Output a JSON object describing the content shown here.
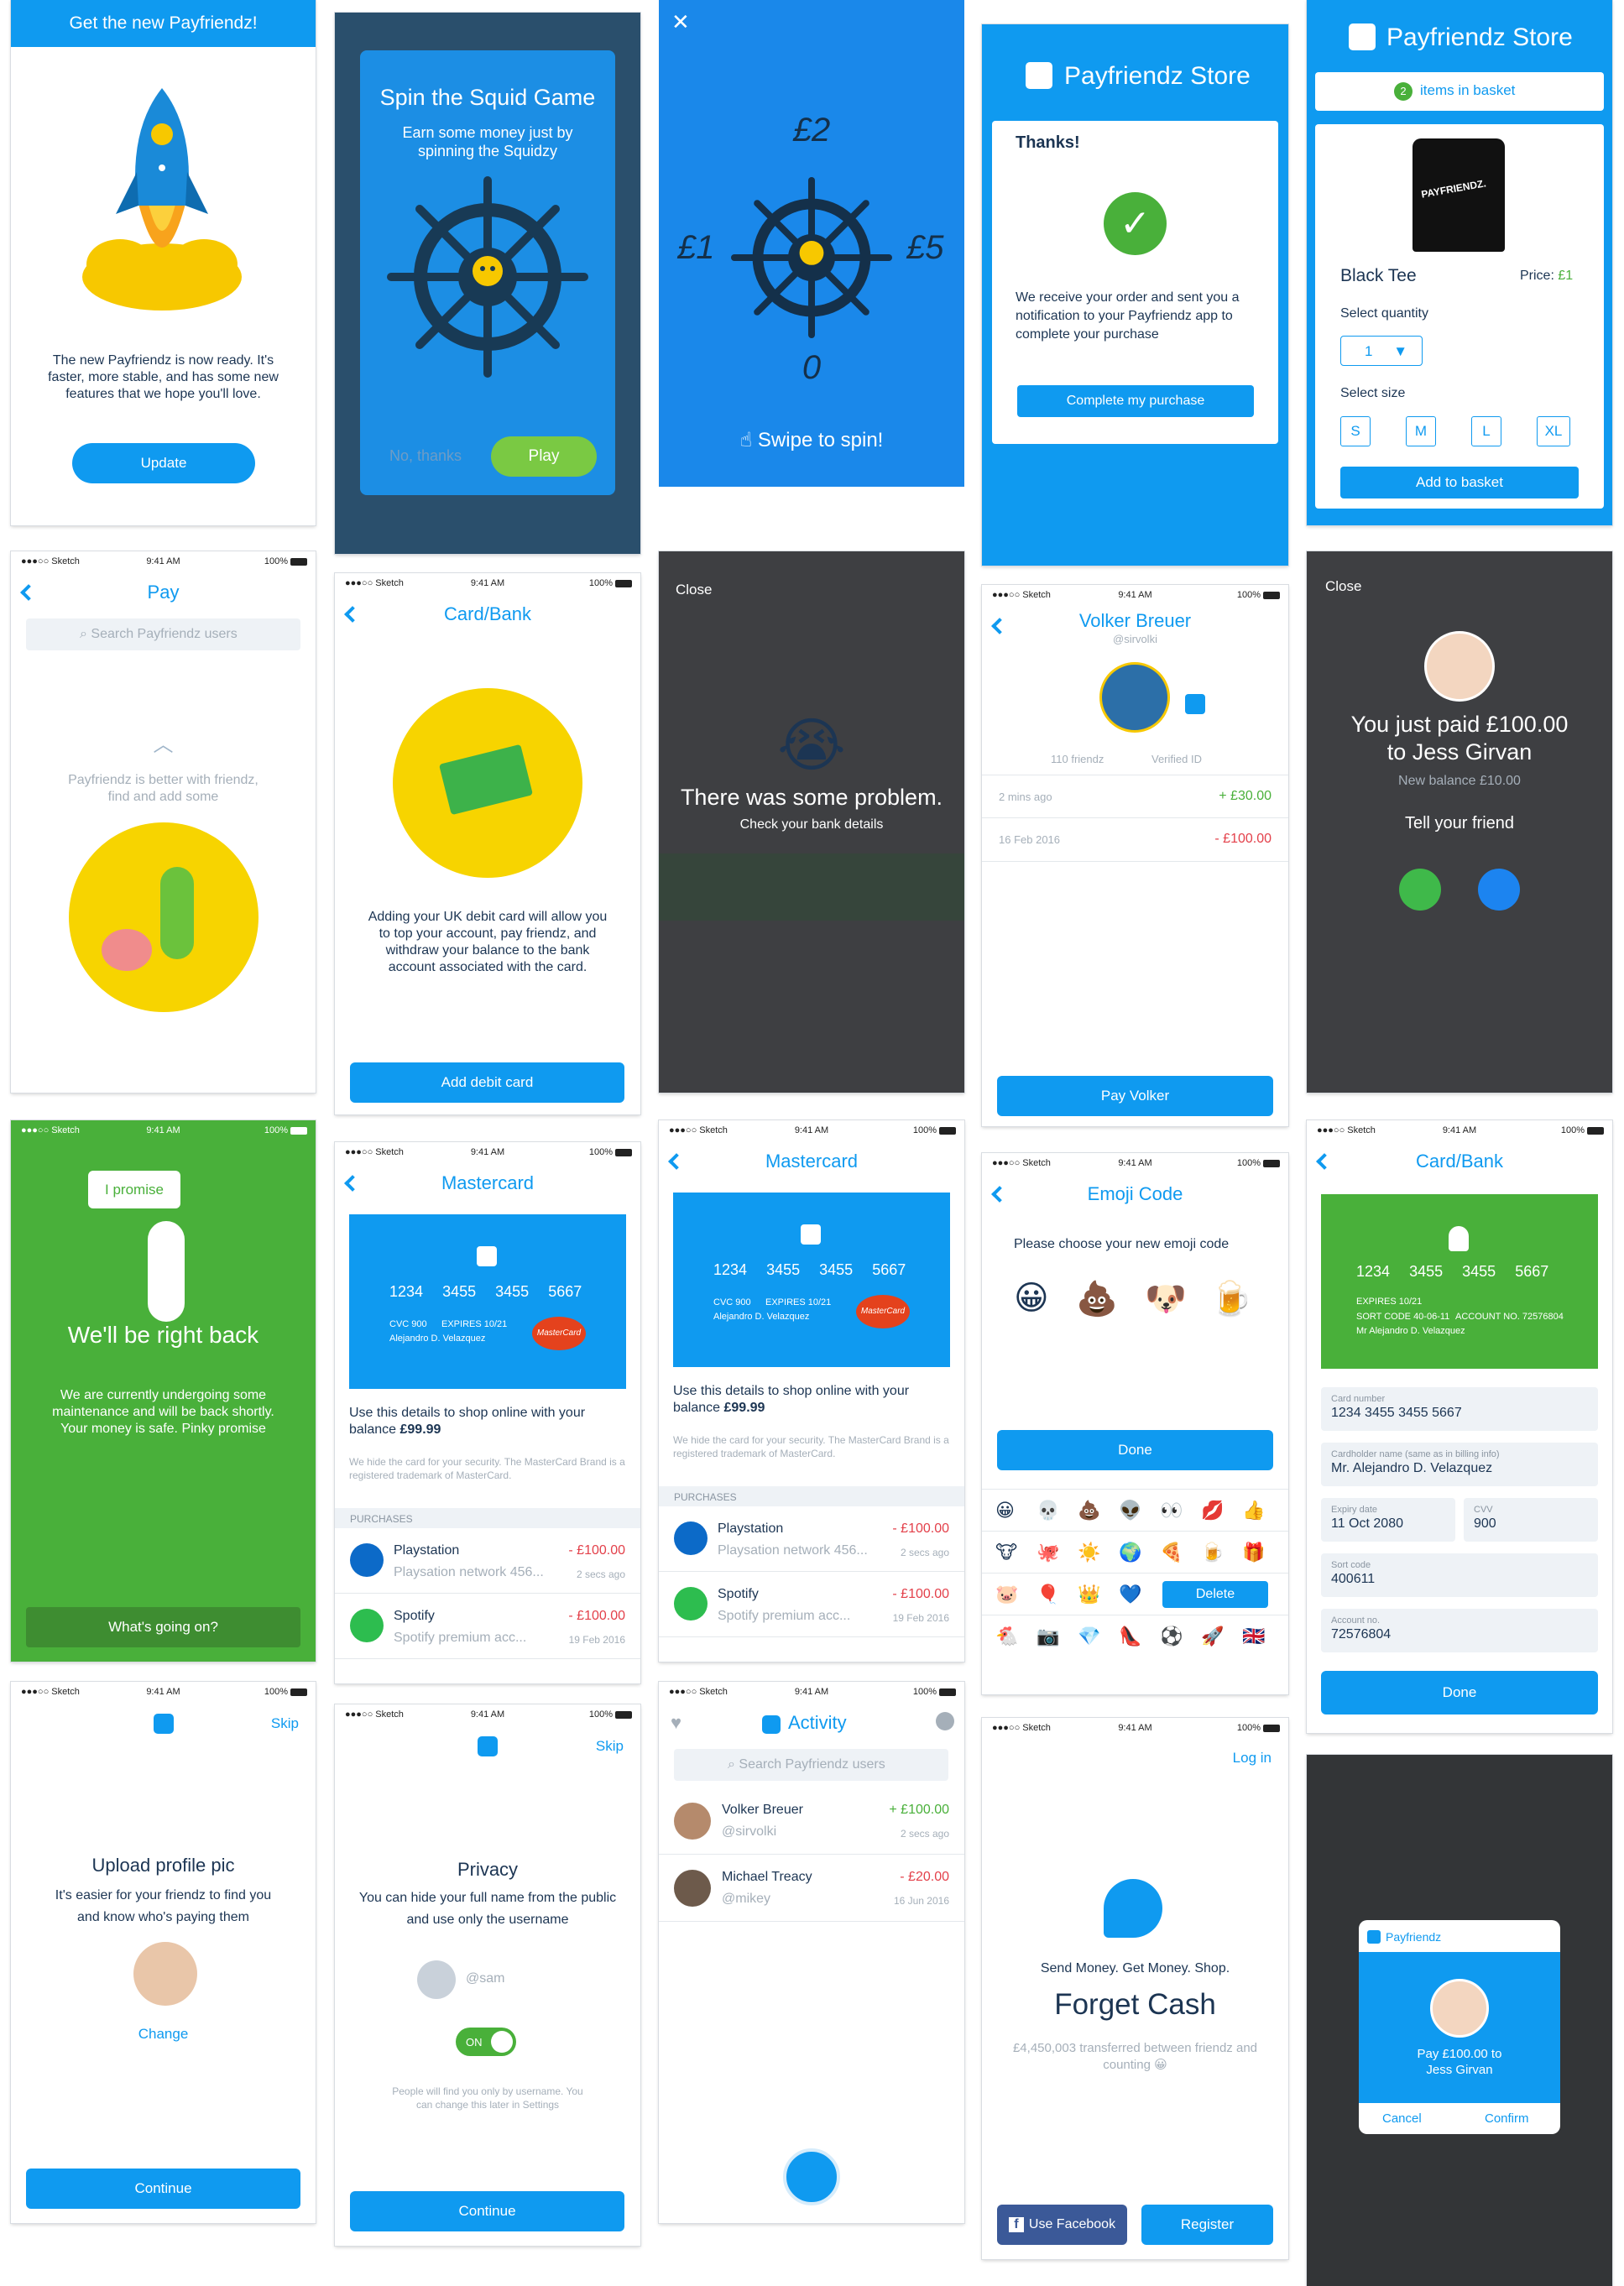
{
  "s1": {
    "header": "Get the new Payfriendz!",
    "body": "The new Payfriendz is now ready. It's faster, more stable, and has some new features that we hope you'll love.",
    "button": "Update"
  },
  "s2": {
    "title": "Spin the Squid Game",
    "subtitle": "Earn some money just by spinning the Squidzy",
    "no": "No, thanks",
    "play": "Play"
  },
  "s3": {
    "top": "£2",
    "left": "£1",
    "right": "£5",
    "bottom": "0",
    "hint": "Swipe to spin!"
  },
  "s4": {
    "brand": "Payfriendz Store",
    "thanks": "Thanks!",
    "body": "We receive your order and sent you a notification to your Payfriendz app to complete your purchase",
    "button": "Complete my purchase"
  },
  "s5": {
    "brand": "Payfriendz Store",
    "basket_count": "2",
    "basket_label": "items in basket",
    "shirt_text": "PAYFRIENDZ.",
    "product": "Black Tee",
    "price_label": "Price:",
    "price": "£1",
    "qty_label": "Select quantity",
    "qty": "1",
    "size_label": "Select size",
    "sizes": [
      "S",
      "M",
      "L",
      "XL"
    ],
    "button": "Add to basket"
  },
  "status": {
    "carrier": "●●●○○ Sketch",
    "time": "9:41 AM",
    "battery": "100%"
  },
  "s6": {
    "title": "Pay",
    "search": "Search Payfriendz users",
    "hint": "Payfriendz is better with friendz, find and add some"
  },
  "s7": {
    "title": "Card/Bank",
    "body": "Adding your UK debit card will allow you to top your account, pay friendz, and withdraw your balance to the bank account associated with the card.",
    "button": "Add debit card"
  },
  "s8": {
    "close": "Close",
    "title": "There was some problem.",
    "sub": "Check your bank details"
  },
  "s9": {
    "name": "Volker Breuer",
    "handle": "@sirvolki",
    "friends": "110 friendz",
    "verified": "Verified ID",
    "tx": [
      {
        "date": "2 mins ago",
        "amount": "+ £30.00"
      },
      {
        "date": "16 Feb 2016",
        "amount": "- £100.00"
      }
    ],
    "button": "Pay Volker"
  },
  "s10": {
    "close": "Close",
    "title": "You just paid £100.00 to Jess Girvan",
    "balance": "New balance £10.00",
    "tell": "Tell your friend"
  },
  "s11": {
    "bubble": "I promise",
    "title": "We'll be right back",
    "body": "We are currently undergoing some maintenance and will be back shortly. Your money is safe. Pinky promise",
    "button": "What's going on?"
  },
  "mc": {
    "title": "Mastercard",
    "number": [
      "1234",
      "3455",
      "3455",
      "5667"
    ],
    "cvc_label": "CVC",
    "cvc": "900",
    "exp_label": "EXPIRES",
    "exp": "10/21",
    "holder": "Alejandro D. Velazquez",
    "brand": "MasterCard",
    "use": "Use this details to shop online with your balance",
    "balance": "£99.99",
    "note": "We hide the card for your security. The MasterCard Brand is a registered trademark of MasterCard.",
    "purchases": "PURCHASES",
    "tx": [
      {
        "name": "Playstation",
        "desc": "Playsation network 456...",
        "amount": "- £100.00",
        "date": "2 secs ago"
      },
      {
        "name": "Spotify",
        "desc": "Spotify premium acc...",
        "amount": "- £100.00",
        "date": "19 Feb 2016"
      }
    ]
  },
  "s14": {
    "title": "Emoji Code",
    "prompt": "Please choose your new emoji code",
    "chosen": [
      "😀",
      "💩",
      "🐶",
      "🍺"
    ],
    "done": "Done",
    "grid": [
      [
        "😀",
        "💀",
        "💩",
        "👽",
        "👀",
        "💋",
        "👍"
      ],
      [
        "🐮",
        "🐙",
        "☀️",
        "🌍",
        "🍕",
        "🍺",
        "🎁"
      ],
      [
        "🐷",
        "🎈",
        "👑",
        "💙"
      ],
      [
        "🐔",
        "📷",
        "💎",
        "👠",
        "⚽",
        "🚀",
        "🇬🇧"
      ]
    ],
    "delete": "Delete"
  },
  "s15": {
    "title": "Card/Bank",
    "number": [
      "1234",
      "3455",
      "3455",
      "5667"
    ],
    "exp_label": "EXPIRES",
    "exp": "10/21",
    "sort_label": "SORT CODE",
    "sort": "40-06-11",
    "acc_label": "ACCOUNT NO.",
    "acc": "72576804",
    "holder": "Mr Alejandro D. Velazquez",
    "f_card_l": "Card number",
    "f_card": "1234 3455 3455 5667",
    "f_name_l": "Cardholder name (same as in billing info)",
    "f_name": "Mr. Alejandro D. Velazquez",
    "f_exp_l": "Expiry date",
    "f_exp": "11 Oct 2080",
    "f_cvv_l": "CVV",
    "f_cvv": "900",
    "f_sort_l": "Sort code",
    "f_sort": "400611",
    "f_acc_l": "Account no.",
    "f_acc": "72576804",
    "button": "Done"
  },
  "s16": {
    "skip": "Skip",
    "title": "Upload profile pic",
    "body": "It's easier for your friendz to find you and know who's paying them",
    "change": "Change",
    "button": "Continue"
  },
  "s17": {
    "skip": "Skip",
    "title": "Privacy",
    "body": "You can hide your full name from the public and use only the username",
    "user": "@sam",
    "toggle": "ON",
    "note": "People will find you only by username. You can change this later in Settings",
    "button": "Continue"
  },
  "s18": {
    "title": "Activity",
    "search": "Search Payfriendz users",
    "tx": [
      {
        "name": "Volker Breuer",
        "handle": "@sirvolki",
        "amount": "+ £100.00",
        "date": "2 secs ago"
      },
      {
        "name": "Michael Treacy",
        "handle": "@mikey",
        "amount": "- £20.00",
        "date": "16 Jun 2016"
      }
    ]
  },
  "s19": {
    "login": "Log in",
    "tag": "Send Money. Get Money. Shop.",
    "title": "Forget Cash",
    "stat": "£4,450,003 transferred between friendz and counting 😀",
    "fb": "Use Facebook",
    "register": "Register"
  },
  "s20": {
    "brand": "Payfriendz",
    "text": "Pay £100.00 to Jess Girvan",
    "cancel": "Cancel",
    "confirm": "Confirm"
  }
}
